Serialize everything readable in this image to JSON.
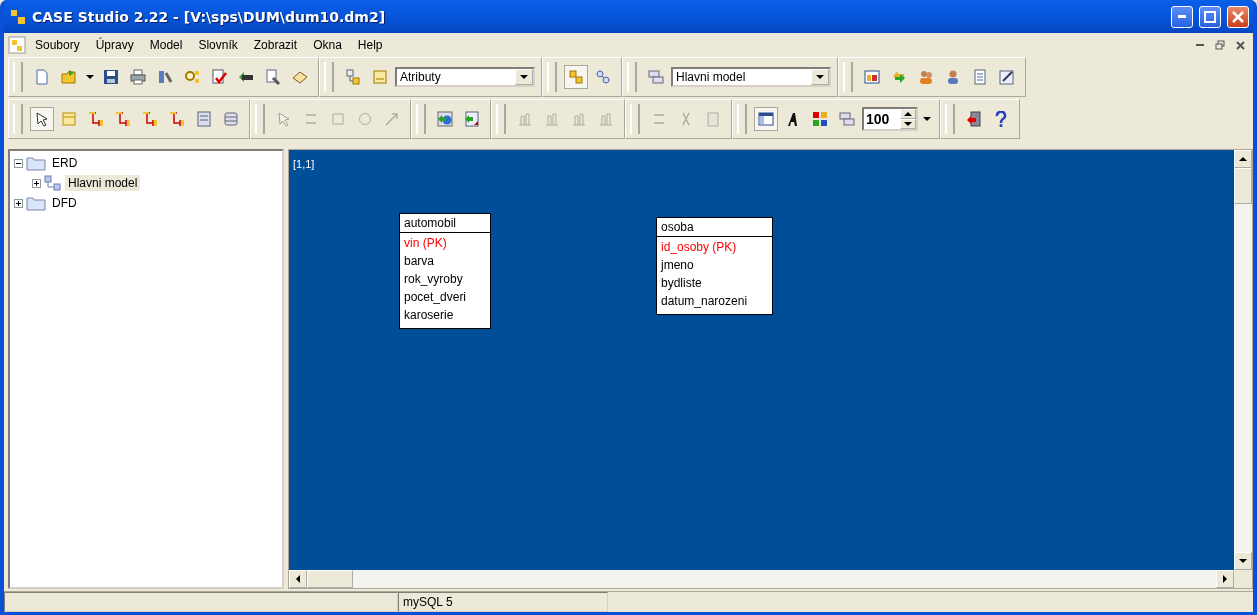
{
  "window": {
    "title": "CASE Studio 2.22 - [V:\\sps\\DUM\\dum10.dm2]"
  },
  "menu": [
    "Soubory",
    "Úpravy",
    "Model",
    "Slovník",
    "Zobrazit",
    "Okna",
    "Help"
  ],
  "toolbar_rows": [
    {
      "groups": [
        {
          "items": [
            {
              "kind": "new",
              "selected": false,
              "disabled": false
            },
            {
              "kind": "open",
              "selected": false,
              "disabled": false
            },
            {
              "kind": "caret",
              "selected": false,
              "disabled": false
            },
            {
              "kind": "save",
              "selected": false,
              "disabled": false
            },
            {
              "kind": "print",
              "selected": false,
              "disabled": false
            },
            {
              "kind": "tools",
              "selected": false,
              "disabled": false
            },
            {
              "kind": "search",
              "selected": false,
              "disabled": false
            },
            {
              "kind": "check",
              "selected": false,
              "disabled": false
            },
            {
              "kind": "sql",
              "selected": false,
              "disabled": false
            },
            {
              "kind": "edit",
              "selected": false,
              "disabled": false
            },
            {
              "kind": "book",
              "selected": false,
              "disabled": false
            }
          ]
        },
        {
          "items": [
            {
              "kind": "diagram",
              "selected": false,
              "disabled": false
            },
            {
              "kind": "index",
              "selected": false,
              "disabled": false
            },
            {
              "kind": "dropdown",
              "value": "Atributy"
            }
          ]
        },
        {
          "items": [
            {
              "kind": "entities",
              "selected": true,
              "disabled": false
            },
            {
              "kind": "circles",
              "selected": false,
              "disabled": false
            }
          ]
        },
        {
          "items": [
            {
              "kind": "stack",
              "selected": false,
              "disabled": false
            },
            {
              "kind": "dropdown",
              "value": "Hlavni model"
            }
          ]
        },
        {
          "items": [
            {
              "kind": "table",
              "selected": false,
              "disabled": false
            },
            {
              "kind": "refresh",
              "selected": false,
              "disabled": false
            },
            {
              "kind": "users",
              "selected": false,
              "disabled": false
            },
            {
              "kind": "user",
              "selected": false,
              "disabled": false
            },
            {
              "kind": "notes",
              "selected": false,
              "disabled": false
            },
            {
              "kind": "pencil",
              "selected": false,
              "disabled": false
            }
          ]
        }
      ]
    },
    {
      "groups": [
        {
          "items": [
            {
              "kind": "pointer",
              "selected": true,
              "disabled": false
            },
            {
              "kind": "entity",
              "selected": false,
              "disabled": false
            },
            {
              "kind": "relation",
              "selected": false,
              "disabled": false
            },
            {
              "kind": "relation",
              "selected": false,
              "disabled": false
            },
            {
              "kind": "relation",
              "selected": false,
              "disabled": false
            },
            {
              "kind": "relation",
              "selected": false,
              "disabled": false
            },
            {
              "kind": "view",
              "selected": false,
              "disabled": false
            },
            {
              "kind": "grid",
              "selected": false,
              "disabled": false
            }
          ]
        },
        {
          "items": [
            {
              "kind": "pointer",
              "selected": false,
              "disabled": true
            },
            {
              "kind": "lines",
              "selected": false,
              "disabled": true
            },
            {
              "kind": "rect",
              "selected": false,
              "disabled": true
            },
            {
              "kind": "circle",
              "selected": false,
              "disabled": true
            },
            {
              "kind": "arrow",
              "selected": false,
              "disabled": true
            }
          ]
        },
        {
          "items": [
            {
              "kind": "import",
              "selected": false,
              "disabled": false
            },
            {
              "kind": "export",
              "selected": false,
              "disabled": false
            }
          ]
        },
        {
          "items": [
            {
              "kind": "align",
              "selected": false,
              "disabled": true
            },
            {
              "kind": "align",
              "selected": false,
              "disabled": true
            },
            {
              "kind": "align",
              "selected": false,
              "disabled": true
            },
            {
              "kind": "align",
              "selected": false,
              "disabled": true
            }
          ]
        },
        {
          "items": [
            {
              "kind": "lines",
              "selected": false,
              "disabled": true
            },
            {
              "kind": "cut",
              "selected": false,
              "disabled": true
            },
            {
              "kind": "paste",
              "selected": false,
              "disabled": true
            }
          ]
        },
        {
          "items": [
            {
              "kind": "layout",
              "selected": true,
              "disabled": false
            },
            {
              "kind": "font",
              "selected": false,
              "disabled": false
            },
            {
              "kind": "colors",
              "selected": false,
              "disabled": false
            },
            {
              "kind": "stack",
              "selected": false,
              "disabled": false
            },
            {
              "kind": "spinner",
              "value": "100"
            },
            {
              "kind": "caret",
              "selected": false,
              "disabled": false
            }
          ]
        },
        {
          "items": [
            {
              "kind": "exit",
              "selected": false,
              "disabled": false
            },
            {
              "kind": "help",
              "selected": false,
              "disabled": false
            }
          ]
        }
      ]
    }
  ],
  "tree": [
    {
      "label": "ERD",
      "kind": "folder",
      "expanded": true,
      "selected": false,
      "children": [
        {
          "label": "Hlavni model",
          "kind": "model",
          "expanded": false,
          "selected": true
        }
      ]
    },
    {
      "label": "DFD",
      "kind": "folder",
      "expanded": false,
      "selected": false
    }
  ],
  "canvas": {
    "position": "[1,1]",
    "entities": [
      {
        "name": "automobil",
        "attributes": [
          {
            "name": "vin (PK)",
            "primary_key": true
          },
          {
            "name": "barva",
            "primary_key": false
          },
          {
            "name": "rok_vyroby",
            "primary_key": false
          },
          {
            "name": "pocet_dveri",
            "primary_key": false
          },
          {
            "name": "karoserie",
            "primary_key": false
          }
        ]
      },
      {
        "name": "osoba",
        "attributes": [
          {
            "name": "id_osoby (PK)",
            "primary_key": true
          },
          {
            "name": "jmeno",
            "primary_key": false
          },
          {
            "name": "bydliste",
            "primary_key": false
          },
          {
            "name": "datum_narozeni",
            "primary_key": false
          }
        ]
      }
    ]
  },
  "status_bar": [
    "mySQL 5"
  ]
}
